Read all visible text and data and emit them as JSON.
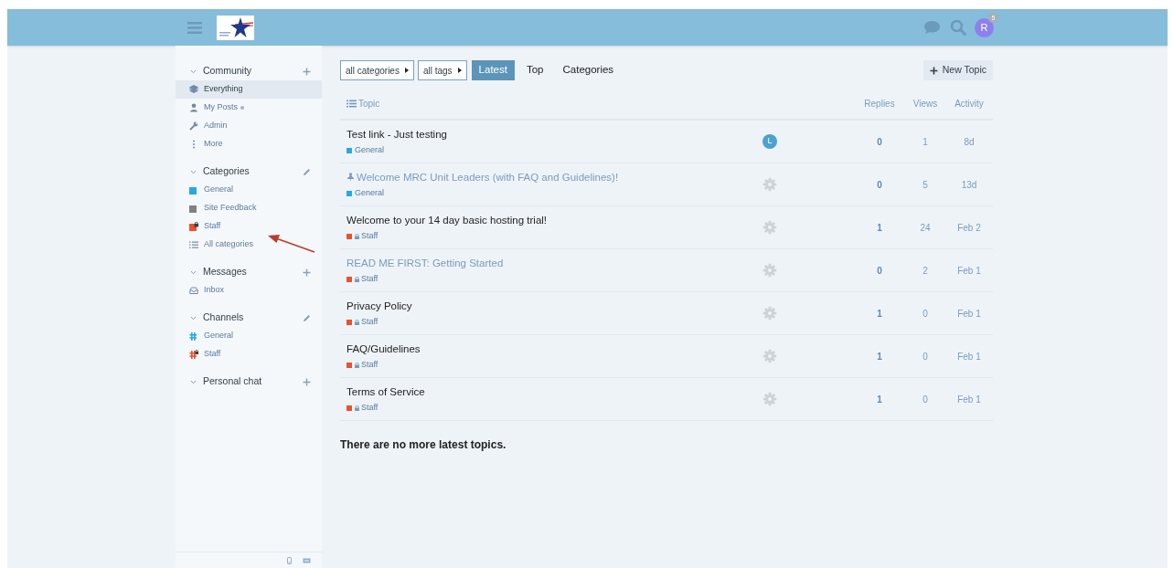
{
  "header": {
    "avatar_letter": "R",
    "notification_count": "5"
  },
  "sidebar": {
    "sections": [
      {
        "title": "Community",
        "editable": false,
        "expanded": true,
        "items": [
          {
            "kind": "link",
            "label": "Everything",
            "selected": true,
            "unread": false
          },
          {
            "kind": "link",
            "label": "My Posts",
            "selected": false,
            "unread": true
          },
          {
            "kind": "link",
            "label": "Admin",
            "selected": false,
            "unread": false
          },
          {
            "kind": "link",
            "label": "More",
            "selected": false,
            "unread": false
          }
        ]
      },
      {
        "title": "Categories",
        "editable": true,
        "expanded": true,
        "items": [
          {
            "kind": "category",
            "label": "General",
            "color": "#25aae2",
            "locked": false,
            "selected": false
          },
          {
            "kind": "category",
            "label": "Site Feedback",
            "color": "#808281",
            "locked": false,
            "selected": false
          },
          {
            "kind": "category",
            "label": "Staff",
            "color": "#e9522c",
            "locked": true,
            "selected": false
          },
          {
            "kind": "all",
            "label": "All categories",
            "selected": false
          }
        ]
      },
      {
        "title": "Messages",
        "editable": false,
        "expanded": true,
        "items": [
          {
            "kind": "inbox",
            "label": "Inbox",
            "selected": false
          }
        ]
      },
      {
        "title": "Channels",
        "editable": true,
        "expanded": true,
        "items": [
          {
            "kind": "channel",
            "label": "General",
            "color": "#25aae2",
            "locked": false,
            "selected": false
          },
          {
            "kind": "channel",
            "label": "Staff",
            "color": "#e9522c",
            "locked": true,
            "selected": false
          }
        ]
      },
      {
        "title": "Personal chat",
        "editable": false,
        "expanded": true
      }
    ]
  },
  "filters": {
    "dropdowns": [
      "all categories",
      "all tags"
    ],
    "tabs": [
      {
        "label": "Latest",
        "selected": true
      },
      {
        "label": "Top",
        "selected": false
      },
      {
        "label": "Categories",
        "selected": false
      }
    ],
    "new_topic_button": "New Topic"
  },
  "table": {
    "columns": [
      "Topic",
      "Replies",
      "Views",
      "Activity"
    ],
    "rows": [
      {
        "title": "Test link - Just testing",
        "visited": false,
        "pinned": false,
        "category": "General",
        "color": "#25aae2",
        "locked": false,
        "poster": {
          "kind": "letter",
          "letter": "L"
        },
        "replies": "0",
        "views": "1",
        "activity": "8d"
      },
      {
        "title": "Welcome MRC Unit Leaders (with FAQ and Guidelines)!",
        "visited": true,
        "pinned": true,
        "category": "General",
        "color": "#25aae2",
        "locked": false,
        "poster": {
          "kind": "system"
        },
        "replies": "0",
        "views": "5",
        "activity": "13d"
      },
      {
        "title": "Welcome to your 14 day basic hosting trial!",
        "visited": false,
        "pinned": false,
        "category": "Staff",
        "color": "#e9522c",
        "locked": true,
        "poster": {
          "kind": "system"
        },
        "replies": "1",
        "views": "24",
        "activity": "Feb 2"
      },
      {
        "title": "READ ME FIRST: Getting Started",
        "visited": true,
        "pinned": false,
        "category": "Staff",
        "color": "#e9522c",
        "locked": true,
        "poster": {
          "kind": "system"
        },
        "replies": "0",
        "views": "2",
        "activity": "Feb 1"
      },
      {
        "title": "Privacy Policy",
        "visited": false,
        "pinned": false,
        "category": "Staff",
        "color": "#e9522c",
        "locked": true,
        "poster": {
          "kind": "system"
        },
        "replies": "1",
        "views": "0",
        "activity": "Feb 1"
      },
      {
        "title": "FAQ/Guidelines",
        "visited": false,
        "pinned": false,
        "category": "Staff",
        "color": "#e9522c",
        "locked": true,
        "poster": {
          "kind": "system"
        },
        "replies": "1",
        "views": "0",
        "activity": "Feb 1"
      },
      {
        "title": "Terms of Service",
        "visited": false,
        "pinned": false,
        "category": "Staff",
        "color": "#e9522c",
        "locked": true,
        "poster": {
          "kind": "system"
        },
        "replies": "1",
        "views": "0",
        "activity": "Feb 1"
      }
    ]
  },
  "footer_message": "There are no more latest topics."
}
